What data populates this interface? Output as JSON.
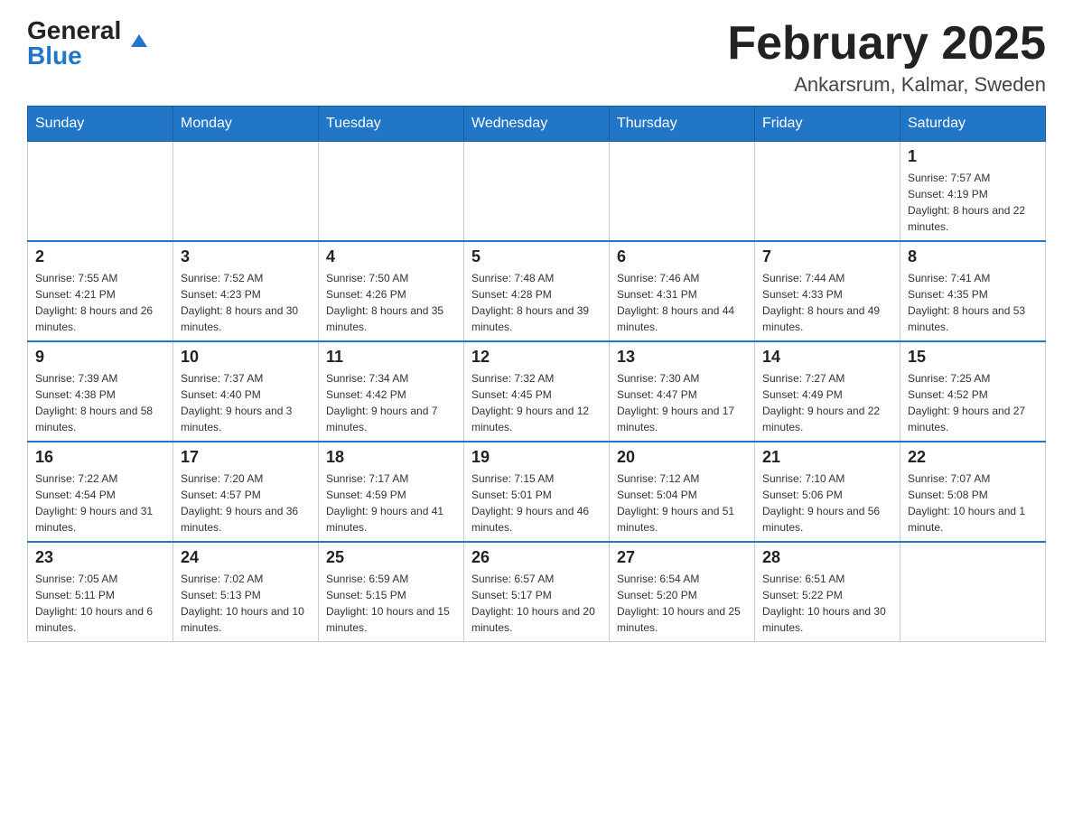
{
  "header": {
    "logo_general": "General",
    "logo_blue": "Blue",
    "month_title": "February 2025",
    "location": "Ankarsrum, Kalmar, Sweden"
  },
  "weekdays": [
    "Sunday",
    "Monday",
    "Tuesday",
    "Wednesday",
    "Thursday",
    "Friday",
    "Saturday"
  ],
  "weeks": [
    [
      {
        "day": "",
        "info": ""
      },
      {
        "day": "",
        "info": ""
      },
      {
        "day": "",
        "info": ""
      },
      {
        "day": "",
        "info": ""
      },
      {
        "day": "",
        "info": ""
      },
      {
        "day": "",
        "info": ""
      },
      {
        "day": "1",
        "info": "Sunrise: 7:57 AM\nSunset: 4:19 PM\nDaylight: 8 hours and 22 minutes."
      }
    ],
    [
      {
        "day": "2",
        "info": "Sunrise: 7:55 AM\nSunset: 4:21 PM\nDaylight: 8 hours and 26 minutes."
      },
      {
        "day": "3",
        "info": "Sunrise: 7:52 AM\nSunset: 4:23 PM\nDaylight: 8 hours and 30 minutes."
      },
      {
        "day": "4",
        "info": "Sunrise: 7:50 AM\nSunset: 4:26 PM\nDaylight: 8 hours and 35 minutes."
      },
      {
        "day": "5",
        "info": "Sunrise: 7:48 AM\nSunset: 4:28 PM\nDaylight: 8 hours and 39 minutes."
      },
      {
        "day": "6",
        "info": "Sunrise: 7:46 AM\nSunset: 4:31 PM\nDaylight: 8 hours and 44 minutes."
      },
      {
        "day": "7",
        "info": "Sunrise: 7:44 AM\nSunset: 4:33 PM\nDaylight: 8 hours and 49 minutes."
      },
      {
        "day": "8",
        "info": "Sunrise: 7:41 AM\nSunset: 4:35 PM\nDaylight: 8 hours and 53 minutes."
      }
    ],
    [
      {
        "day": "9",
        "info": "Sunrise: 7:39 AM\nSunset: 4:38 PM\nDaylight: 8 hours and 58 minutes."
      },
      {
        "day": "10",
        "info": "Sunrise: 7:37 AM\nSunset: 4:40 PM\nDaylight: 9 hours and 3 minutes."
      },
      {
        "day": "11",
        "info": "Sunrise: 7:34 AM\nSunset: 4:42 PM\nDaylight: 9 hours and 7 minutes."
      },
      {
        "day": "12",
        "info": "Sunrise: 7:32 AM\nSunset: 4:45 PM\nDaylight: 9 hours and 12 minutes."
      },
      {
        "day": "13",
        "info": "Sunrise: 7:30 AM\nSunset: 4:47 PM\nDaylight: 9 hours and 17 minutes."
      },
      {
        "day": "14",
        "info": "Sunrise: 7:27 AM\nSunset: 4:49 PM\nDaylight: 9 hours and 22 minutes."
      },
      {
        "day": "15",
        "info": "Sunrise: 7:25 AM\nSunset: 4:52 PM\nDaylight: 9 hours and 27 minutes."
      }
    ],
    [
      {
        "day": "16",
        "info": "Sunrise: 7:22 AM\nSunset: 4:54 PM\nDaylight: 9 hours and 31 minutes."
      },
      {
        "day": "17",
        "info": "Sunrise: 7:20 AM\nSunset: 4:57 PM\nDaylight: 9 hours and 36 minutes."
      },
      {
        "day": "18",
        "info": "Sunrise: 7:17 AM\nSunset: 4:59 PM\nDaylight: 9 hours and 41 minutes."
      },
      {
        "day": "19",
        "info": "Sunrise: 7:15 AM\nSunset: 5:01 PM\nDaylight: 9 hours and 46 minutes."
      },
      {
        "day": "20",
        "info": "Sunrise: 7:12 AM\nSunset: 5:04 PM\nDaylight: 9 hours and 51 minutes."
      },
      {
        "day": "21",
        "info": "Sunrise: 7:10 AM\nSunset: 5:06 PM\nDaylight: 9 hours and 56 minutes."
      },
      {
        "day": "22",
        "info": "Sunrise: 7:07 AM\nSunset: 5:08 PM\nDaylight: 10 hours and 1 minute."
      }
    ],
    [
      {
        "day": "23",
        "info": "Sunrise: 7:05 AM\nSunset: 5:11 PM\nDaylight: 10 hours and 6 minutes."
      },
      {
        "day": "24",
        "info": "Sunrise: 7:02 AM\nSunset: 5:13 PM\nDaylight: 10 hours and 10 minutes."
      },
      {
        "day": "25",
        "info": "Sunrise: 6:59 AM\nSunset: 5:15 PM\nDaylight: 10 hours and 15 minutes."
      },
      {
        "day": "26",
        "info": "Sunrise: 6:57 AM\nSunset: 5:17 PM\nDaylight: 10 hours and 20 minutes."
      },
      {
        "day": "27",
        "info": "Sunrise: 6:54 AM\nSunset: 5:20 PM\nDaylight: 10 hours and 25 minutes."
      },
      {
        "day": "28",
        "info": "Sunrise: 6:51 AM\nSunset: 5:22 PM\nDaylight: 10 hours and 30 minutes."
      },
      {
        "day": "",
        "info": ""
      }
    ]
  ]
}
